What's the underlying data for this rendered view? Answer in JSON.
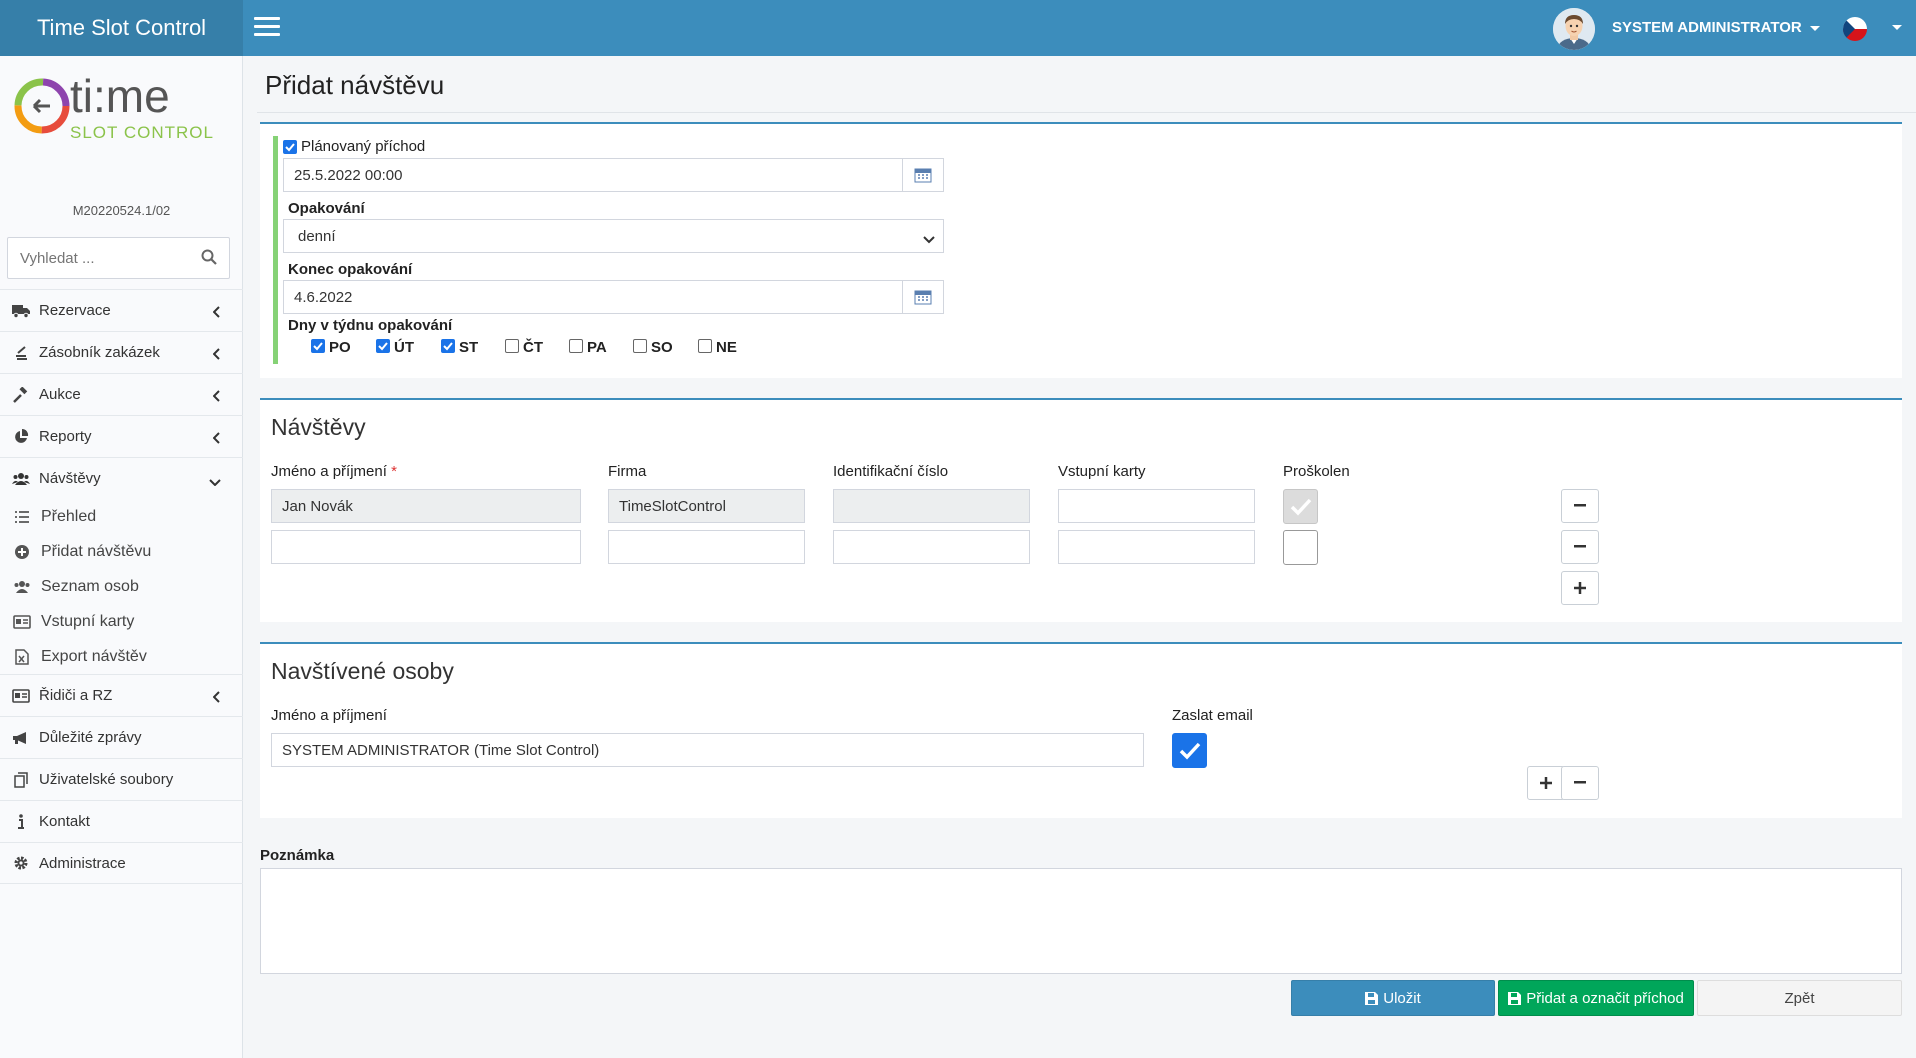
{
  "app": {
    "title": "Time Slot Control",
    "version": "M20220524.1/02"
  },
  "logo": {
    "word": "ti:me",
    "subtitle": "SLOT CONTROL"
  },
  "header": {
    "user_name": "SYSTEM ADMINISTRATOR",
    "language_flag": "czech-flag"
  },
  "search": {
    "placeholder": "Vyhledat ..."
  },
  "sidebar": {
    "items": [
      {
        "label": "Rezervace",
        "icon": "truck-icon"
      },
      {
        "label": "Zásobník zakázek",
        "icon": "stack-icon"
      },
      {
        "label": "Aukce",
        "icon": "gavel-icon"
      },
      {
        "label": "Reporty",
        "icon": "pie-chart-icon"
      },
      {
        "label": "Návštěvy",
        "icon": "users-icon"
      },
      {
        "label": "Řidiči a RZ",
        "icon": "id-card-icon"
      },
      {
        "label": "Důležité zprávy",
        "icon": "megaphone-icon"
      },
      {
        "label": "Uživatelské soubory",
        "icon": "copy-icon"
      },
      {
        "label": "Kontakt",
        "icon": "info-icon"
      },
      {
        "label": "Administrace",
        "icon": "gear-icon"
      }
    ],
    "subitems": [
      {
        "label": "Přehled",
        "icon": "list-icon"
      },
      {
        "label": "Přidat návštěvu",
        "icon": "plus-circle-icon"
      },
      {
        "label": "Seznam osob",
        "icon": "users-icon"
      },
      {
        "label": "Vstupní karty",
        "icon": "card-icon"
      },
      {
        "label": "Export návštěv",
        "icon": "excel-icon"
      }
    ]
  },
  "page": {
    "title": "Přidat návštěvu"
  },
  "schedule": {
    "planned_label": "Plánovaný příchod",
    "planned_checked": true,
    "planned_value": "25.5.2022 00:00",
    "repeat_label": "Opakování",
    "repeat_value": "denní",
    "end_label": "Konec opakování",
    "end_value": "4.6.2022",
    "days_label": "Dny v týdnu opakování",
    "days": [
      {
        "label": "PO",
        "checked": true
      },
      {
        "label": "ÚT",
        "checked": true
      },
      {
        "label": "ST",
        "checked": true
      },
      {
        "label": "ČT",
        "checked": false
      },
      {
        "label": "PA",
        "checked": false
      },
      {
        "label": "SO",
        "checked": false
      },
      {
        "label": "NE",
        "checked": false
      }
    ]
  },
  "visits": {
    "title": "Návštěvy",
    "columns": {
      "name": "Jméno a příjmení",
      "required_mark": "*",
      "company": "Firma",
      "id_number": "Identifikační číslo",
      "cards": "Vstupní karty",
      "trained": "Proškolen"
    },
    "rows": [
      {
        "name": "Jan Novák",
        "company": "TimeSlotControl",
        "id_number": "",
        "cards": "",
        "trained": true
      },
      {
        "name": "",
        "company": "",
        "id_number": "",
        "cards": "",
        "trained": false
      }
    ]
  },
  "visited": {
    "title": "Navštívené osoby",
    "name_label": "Jméno a příjmení",
    "email_label": "Zaslat email",
    "rows": [
      {
        "name": "SYSTEM ADMINISTRATOR (Time Slot Control)",
        "send_email": true
      }
    ]
  },
  "note": {
    "label": "Poznámka",
    "value": ""
  },
  "buttons": {
    "save": "Uložit",
    "add_mark": "Přidat a označit příchod",
    "back": "Zpět"
  },
  "colors": {
    "primary": "#3c8dbc",
    "primary_dark": "#367fa9",
    "success": "#00a65a",
    "accent_green": "#86d276",
    "checkbox_blue": "#1a73e8"
  }
}
